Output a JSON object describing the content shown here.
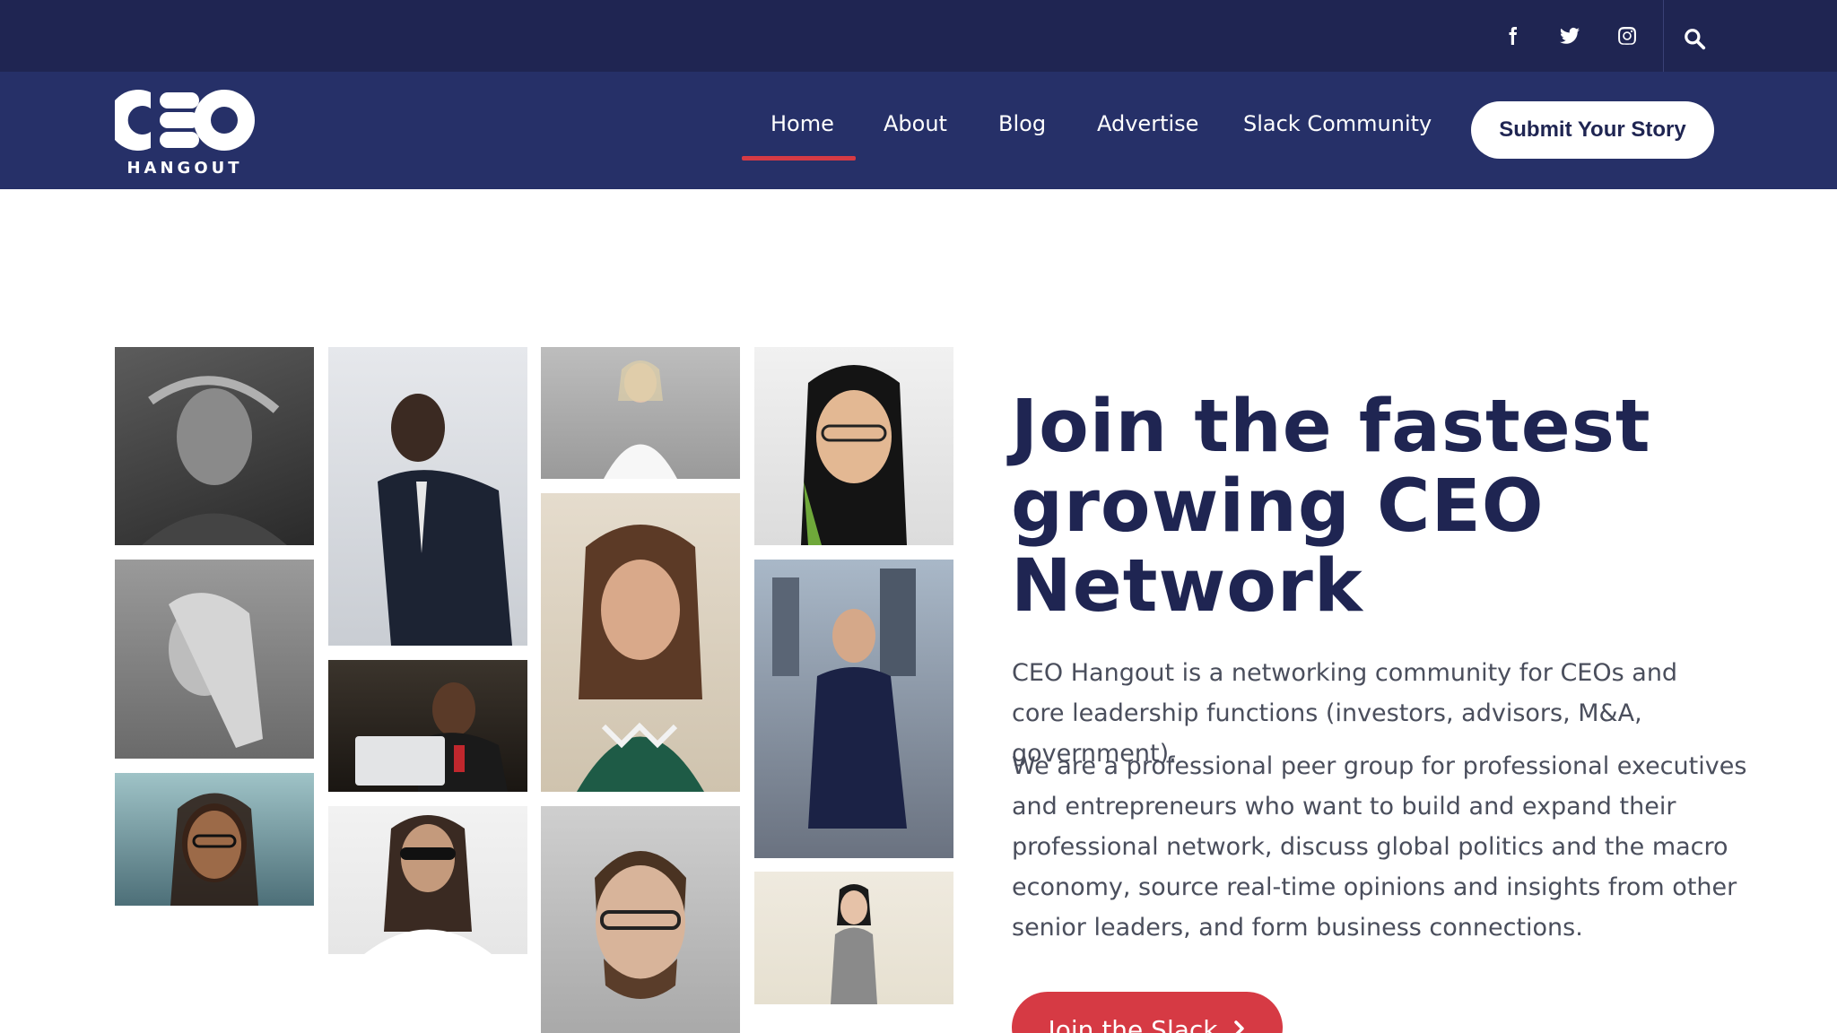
{
  "social": {
    "facebook": "facebook-icon",
    "twitter": "twitter-icon",
    "instagram": "instagram-icon",
    "search": "search-icon"
  },
  "logo": {
    "big": "CEO",
    "small": "HANGOUT"
  },
  "nav": {
    "items": [
      {
        "label": "Home",
        "active": true
      },
      {
        "label": "About"
      },
      {
        "label": "Blog"
      },
      {
        "label": "Advertise"
      },
      {
        "label": "Slack Community"
      }
    ],
    "submit_label": "Submit Your Story"
  },
  "hero": {
    "title": "Join the fastest growing CEO Network",
    "paragraph_1": "CEO Hangout is a networking community for CEOs and core leadership functions (investors, advisors, M&A, government).",
    "paragraph_2": "We are a professional peer group for professional executives and entrepreneurs who want to build and expand their professional network, discuss global politics and the macro economy, source real-time opinions and insights from other senior leaders, and form business connections.",
    "cta_label": "Join the Slack"
  },
  "colors": {
    "topbar": "#1f2552",
    "navbar": "#263068",
    "accent_red": "#d63a44",
    "title_navy": "#1f2552"
  }
}
